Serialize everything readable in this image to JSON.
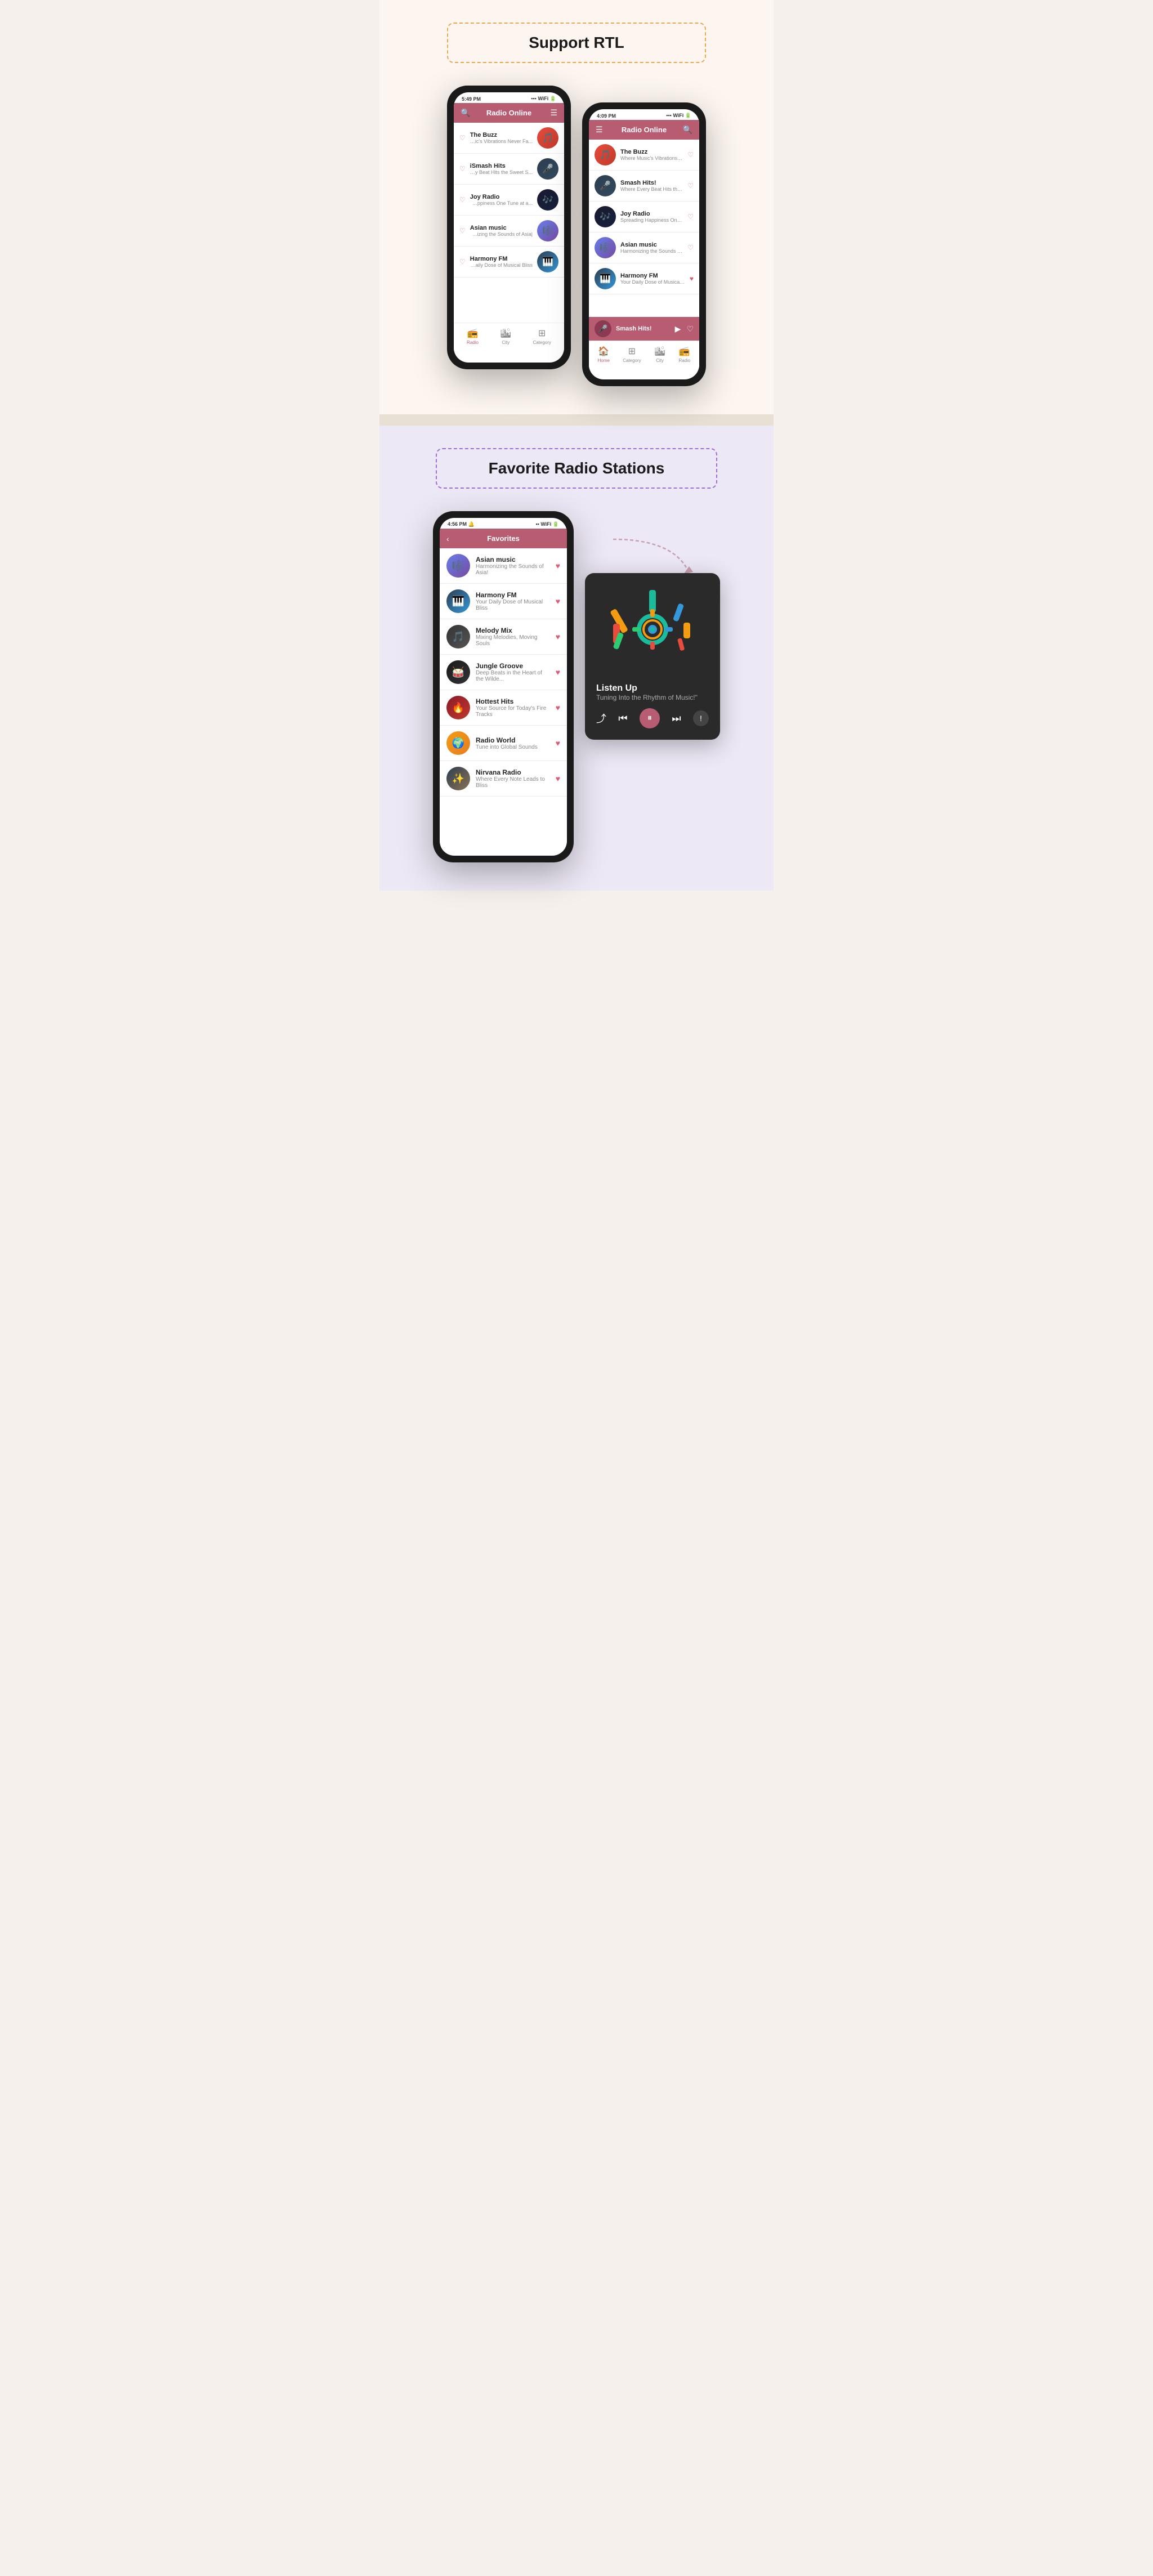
{
  "sections": {
    "rtl": {
      "title": "Support RTL",
      "phone1": {
        "time": "5:49 PM",
        "title": "Radio Online",
        "stations": [
          {
            "name": "The Buzz",
            "desc": "...Where Music's Vibrations Never Fa",
            "emoji": "🎵",
            "avClass": "av-buzz"
          },
          {
            "name": "iSmash Hits",
            "desc": "...Where Every Beat Hits the Sweet S",
            "emoji": "🎤",
            "avClass": "av-ismash"
          },
          {
            "name": "Joy Radio",
            "desc": "...Spreading Happiness One Tune at a",
            "emoji": "🎶",
            "avClass": "av-joy"
          },
          {
            "name": "Asian music",
            "desc": "|Harmonizing the Sounds of Asia",
            "emoji": "🎼",
            "avClass": "av-asian"
          },
          {
            "name": "Harmony FM",
            "desc": "Your Daily Dose of Musical Bliss",
            "emoji": "🎹",
            "avClass": "av-harmony"
          }
        ],
        "navItems": [
          "Radio",
          "City",
          "Category"
        ],
        "activeNav": "Radio"
      },
      "phone2": {
        "time": "4:09 PM",
        "title": "Radio Online",
        "stations": [
          {
            "name": "The Buzz",
            "desc": "Where Music's Vibrations Never Fa...",
            "emoji": "🎵",
            "avClass": "av-buzz"
          },
          {
            "name": "Smash Hits!",
            "desc": "Where Every Beat Hits the Sweet S...",
            "emoji": "🎤",
            "avClass": "av-ismash"
          },
          {
            "name": "Joy Radio",
            "desc": "Spreading Happiness One Tune at a...",
            "emoji": "🎶",
            "avClass": "av-joy"
          },
          {
            "name": "Asian music",
            "desc": "Harmonizing the Sounds of Asia!",
            "emoji": "🎼",
            "avClass": "av-asian"
          },
          {
            "name": "Harmony FM",
            "desc": "Your Daily Dose of Musical Bliss",
            "emoji": "🎹",
            "avClass": "av-harmony"
          }
        ],
        "miniPlayer": {
          "name": "Smash Hits!",
          "emoji": "🎤"
        },
        "navItems": [
          "Home",
          "Category",
          "City",
          "Radio"
        ],
        "activeNav": "Home"
      }
    },
    "favorites": {
      "title": "Favorite Radio Stations",
      "phone": {
        "time": "4:56 PM",
        "title": "Favorites",
        "stations": [
          {
            "name": "Asian music",
            "desc": "Harmonizing the Sounds of Asia!",
            "emoji": "🎼",
            "avClass": "av-asian"
          },
          {
            "name": "Harmony FM",
            "desc": "Your Daily Dose of Musical Bliss",
            "emoji": "🎹",
            "avClass": "av-harmony"
          },
          {
            "name": "Melody Mix",
            "desc": "Mixing Melodies, Moving Souls",
            "emoji": "🎵",
            "avClass": "av-melody"
          },
          {
            "name": "Jungle Groove",
            "desc": "Deep Beats in the Heart of the Wilde...",
            "emoji": "🥁",
            "avClass": "av-jungle"
          },
          {
            "name": "Hottest Hits",
            "desc": "Your Source for Today's Fire Tracks",
            "emoji": "🔥",
            "avClass": "av-hottest"
          },
          {
            "name": "Radio World",
            "desc": "Tune into Global Sounds",
            "emoji": "🌍",
            "avClass": "av-radio"
          },
          {
            "name": "Nirvana Radio",
            "desc": "Where Every Note Leads to Bliss",
            "emoji": "✨",
            "avClass": "av-nirvana"
          }
        ]
      },
      "player": {
        "trackName": "Listen Up",
        "trackDesc": "Tuning Into the Rhythm of Music!\""
      }
    }
  }
}
